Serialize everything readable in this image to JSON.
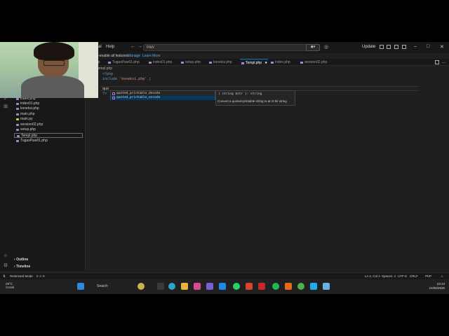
{
  "titlebar": {
    "menu": [
      "al",
      "Help"
    ],
    "search_placeholder": "PAW",
    "update_label": "Update"
  },
  "banner": {
    "text": "-enable all features.",
    "manage": "Manage",
    "learn_more": "Learn More"
  },
  "tabs": [
    {
      "label": "p.php"
    },
    {
      "label": "TugasPaw01.php"
    },
    {
      "label": "index01.php"
    },
    {
      "label": "setup.php"
    },
    {
      "label": "koneksi.php"
    },
    {
      "label": "Templ.php",
      "active": true
    },
    {
      "label": "index.php"
    },
    {
      "label": "session02.php"
    }
  ],
  "explorer": {
    "files": [
      {
        "name": "index.php",
        "type": "php"
      },
      {
        "name": "index01.php",
        "type": "php"
      },
      {
        "name": "koneksi.php",
        "type": "php"
      },
      {
        "name": "main.php",
        "type": "php"
      },
      {
        "name": "main.py",
        "type": "py"
      },
      {
        "name": "session02.php",
        "type": "php"
      },
      {
        "name": "setup.php",
        "type": "php"
      },
      {
        "name": "Templ.php",
        "type": "php",
        "active": true
      },
      {
        "name": "TugasPaw01.php",
        "type": "php"
      }
    ],
    "outline": "Outline",
    "timeline": "Timeline"
  },
  "editor": {
    "breadcrumb": "Templ.php",
    "lines": [
      "<?php",
      "include 'koneksi.php' ;",
      "",
      "quo",
      "?>"
    ],
    "suggestions": [
      "quoted_printable_decode",
      "quoted_printable_encode"
    ],
    "detail_signature": "( string $str ): string",
    "detail_doc": "Convert a quoted-printable string to an 8 bit string"
  },
  "statusbar": {
    "restricted": "Restricted Mode",
    "problems": "0 ⚠ 0",
    "position": "Ln 4, Col 4",
    "spaces": "Spaces: 4",
    "encoding": "UTF-8",
    "eol": "CRLF",
    "language": "PHP"
  },
  "taskbar": {
    "weather_temp": "29°C",
    "weather_desc": "Cerah",
    "search": "Search",
    "time": "23:13",
    "date": "21/05/2026"
  },
  "colors": {
    "accent": "#0078d4",
    "editor_bg": "#1f1f1f",
    "sidebar_bg": "#181818"
  }
}
